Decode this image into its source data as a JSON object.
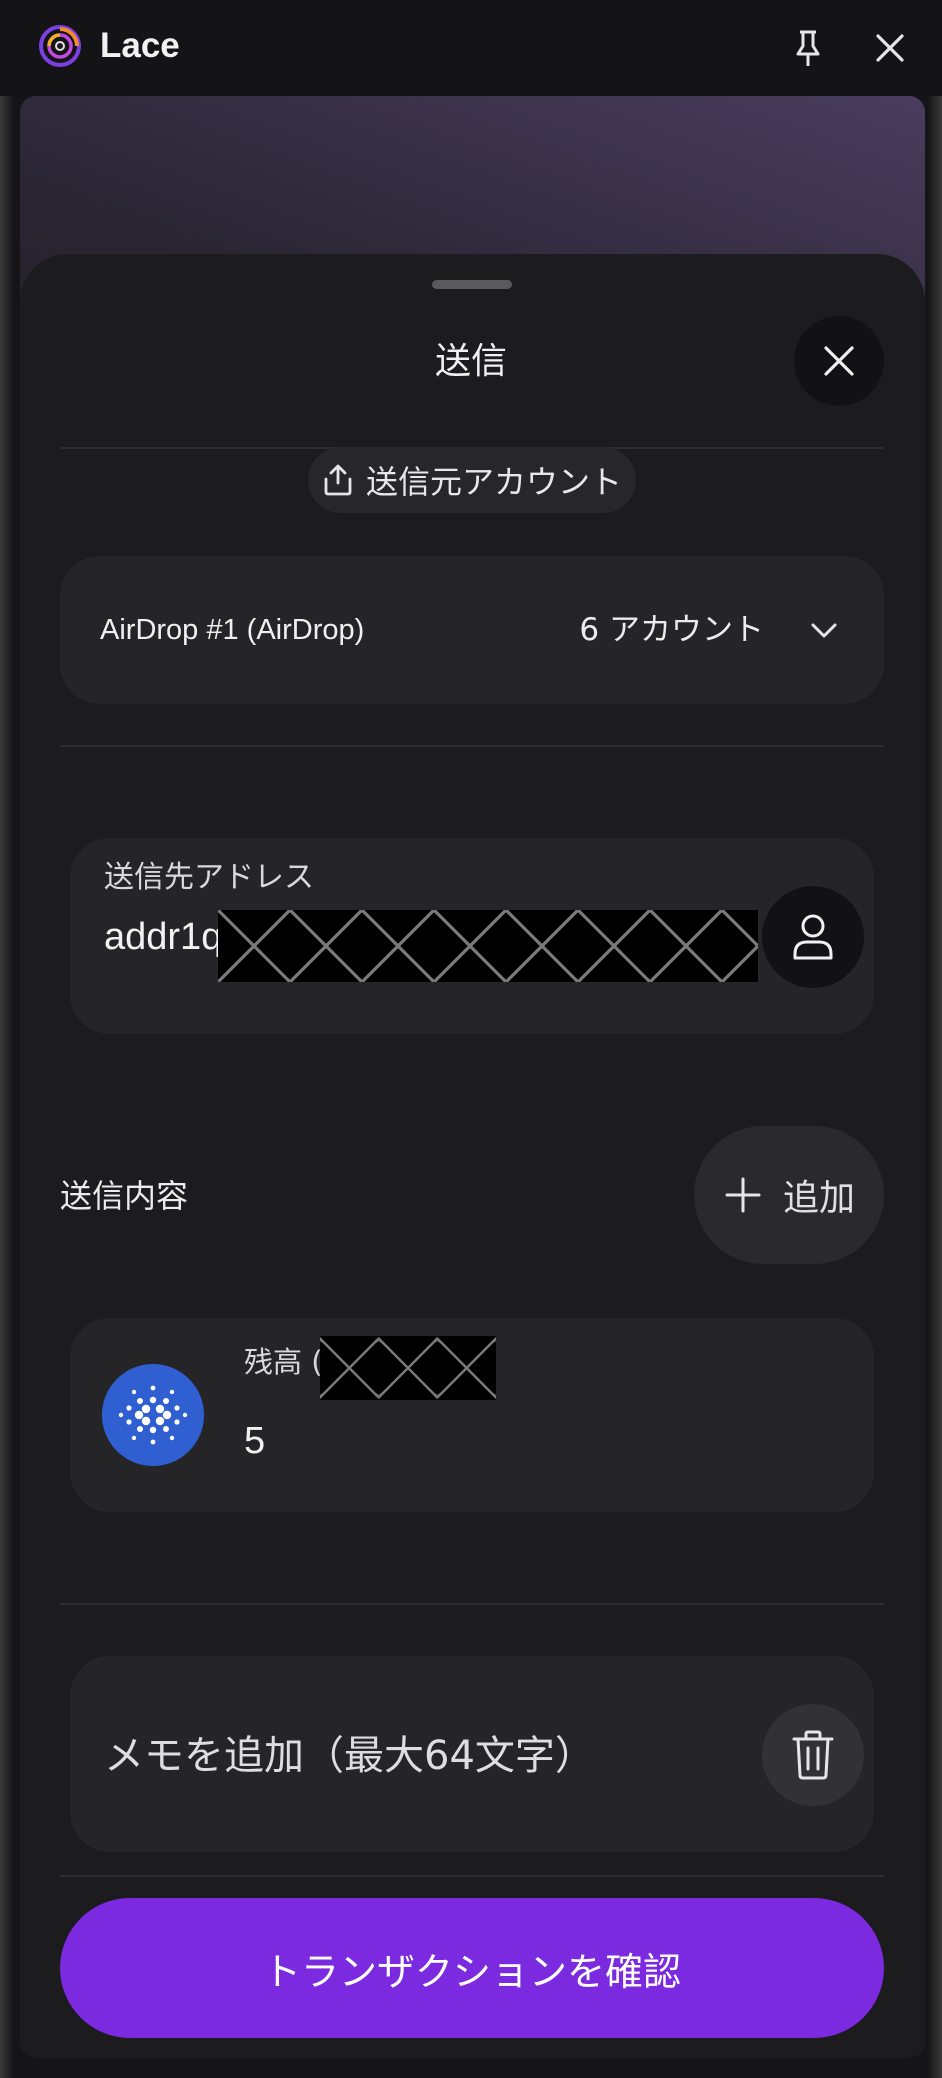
{
  "app": {
    "title": "Lace"
  },
  "sheet": {
    "title": "送信",
    "from_label": "送信元アカウント",
    "account": {
      "name": "AirDrop #1 (AirDrop)",
      "count": "6 アカウント"
    },
    "address": {
      "label": "送信先アドレス",
      "value": "addr1q"
    },
    "content_label": "送信内容",
    "add_button_label": "追加",
    "asset": {
      "balance_label": "残高 (",
      "amount": "5"
    },
    "memo": {
      "placeholder": "メモを追加（最大64文字）"
    },
    "confirm_label": "トランザクションを確認"
  },
  "colors": {
    "accent": "#7b2ae0",
    "ada_blue": "#2f5fd0",
    "card": "#252527",
    "sheet": "#1c1c1e"
  },
  "icons": {
    "logo": "lace-logo",
    "pin": "pin-icon",
    "close": "close-icon",
    "upload": "upload-icon",
    "chevron": "chevron-down-icon",
    "contact": "user-icon",
    "plus": "plus-icon",
    "ada": "cardano-icon",
    "trash": "trash-icon"
  }
}
